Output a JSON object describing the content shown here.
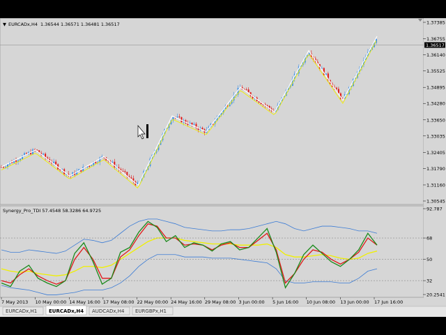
{
  "chart_data": [
    {
      "type": "candlestick",
      "symbol_header": "EURCADx,H4",
      "ohlc_header": "1.36544 1.36571 1.36481 1.36517",
      "current_price_label": "1.36517",
      "y_ticks": [
        "1.37385",
        "1.36755",
        "1.36140",
        "1.35525",
        "1.34895",
        "1.34280",
        "1.33650",
        "1.33035",
        "1.32405",
        "1.31790",
        "1.31160",
        "1.30545"
      ],
      "ylim": [
        1.30545,
        1.37385
      ],
      "x_ticks": [
        "7 May 2013",
        "10 May 00:00",
        "14 May 16:00",
        "17 May 08:00",
        "22 May 00:00",
        "24 May 16:00",
        "29 May 08:00",
        "3 Jun 00:00",
        "5 Jun 16:00",
        "10 Jun 08:00",
        "13 Jun 00:00",
        "17 Jun 16:00"
      ],
      "zigzag": [
        1.3185,
        1.325,
        1.315,
        1.3225,
        1.3115,
        1.338,
        1.332,
        1.349,
        1.3395,
        1.363,
        1.344,
        1.3685
      ],
      "colors": {
        "bull": "#3b8fe8",
        "bear": "#e01818",
        "ma": "#f0f000",
        "zigzag": "#ffffff"
      }
    },
    {
      "type": "line",
      "indicator_header": "Synergy_Pro_TDI 57.4548 58.3286 64.9725",
      "y_ticks": [
        "92.787",
        "68",
        "50",
        "32",
        "20.2541"
      ],
      "ylim": [
        20.2541,
        92.787
      ],
      "levels": [
        68,
        50,
        32
      ],
      "series": [
        {
          "color": "#1a8a1a",
          "values": [
            30,
            27,
            40,
            45,
            34,
            30,
            27,
            32,
            55,
            64,
            48,
            29,
            34,
            56,
            60,
            73,
            82,
            77,
            65,
            70,
            60,
            64,
            62,
            57,
            63,
            65,
            58,
            60,
            68,
            76,
            56,
            26,
            38,
            54,
            62,
            55,
            48,
            44,
            50,
            58,
            72,
            62
          ]
        },
        {
          "color": "#e01818",
          "values": [
            32,
            30,
            37,
            42,
            36,
            32,
            29,
            32,
            50,
            60,
            50,
            34,
            34,
            52,
            58,
            70,
            80,
            78,
            68,
            68,
            62,
            63,
            62,
            58,
            62,
            64,
            60,
            60,
            66,
            72,
            58,
            30,
            38,
            50,
            58,
            56,
            50,
            46,
            50,
            56,
            68,
            62
          ]
        },
        {
          "color": "#f0f000",
          "values": [
            42,
            40,
            39,
            40,
            38,
            37,
            36,
            37,
            40,
            44,
            44,
            43,
            45,
            50,
            55,
            60,
            65,
            68,
            68,
            68,
            66,
            65,
            64,
            63,
            63,
            63,
            62,
            62,
            62,
            63,
            60,
            54,
            52,
            52,
            53,
            54,
            53,
            51,
            50,
            51,
            55,
            57
          ]
        },
        {
          "color": "#3a7bd5",
          "values": [
            58,
            56,
            56,
            58,
            57,
            56,
            55,
            57,
            62,
            67,
            66,
            64,
            66,
            72,
            78,
            82,
            84,
            84,
            82,
            80,
            77,
            76,
            75,
            74,
            74,
            75,
            75,
            76,
            78,
            80,
            82,
            80,
            76,
            74,
            76,
            78,
            78,
            77,
            76,
            74,
            74,
            72
          ]
        },
        {
          "color": "#3a7bd5",
          "values": [
            28,
            26,
            25,
            24,
            22,
            20,
            20,
            21,
            22,
            24,
            24,
            24,
            26,
            30,
            36,
            44,
            50,
            54,
            54,
            54,
            52,
            52,
            52,
            51,
            51,
            51,
            50,
            49,
            48,
            47,
            42,
            32,
            30,
            30,
            31,
            31,
            31,
            30,
            30,
            34,
            40,
            42
          ]
        }
      ]
    }
  ],
  "tabs": [
    "EURCADx,H1",
    "EURCADx,H4",
    "AUDCADx,H4",
    "EURGBPx,H1"
  ],
  "active_tab": 1
}
